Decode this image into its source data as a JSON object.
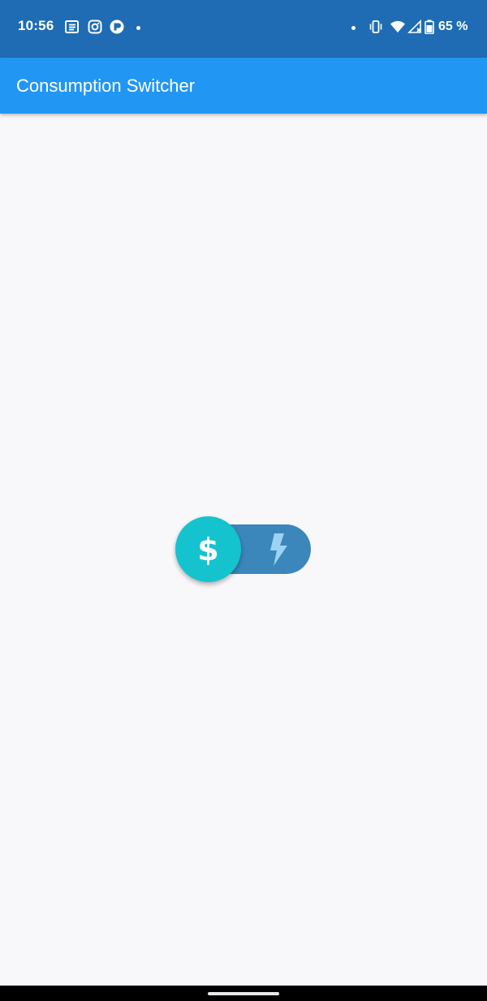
{
  "status_bar": {
    "time": "10:56",
    "battery": "65 %",
    "left_icons": [
      "news-icon",
      "instagram-icon",
      "app-icon",
      "dot-icon"
    ],
    "right_icons": [
      "dot-icon",
      "vibrate-icon",
      "wifi-icon",
      "signal-icon",
      "battery-icon"
    ]
  },
  "app_bar": {
    "title": "Consumption Switcher"
  },
  "consumption_switch": {
    "selected": "cost",
    "thumb_symbol": "$",
    "options": [
      "dollar-icon",
      "bolt-icon"
    ],
    "colors": {
      "track": "#3b86bb",
      "thumb": "#14c3ce",
      "inactive_icon": "#9dd3f2"
    }
  },
  "colors": {
    "status_bar": "#1f6cb4",
    "app_bar": "#2196f3",
    "background": "#f8f7fa"
  }
}
